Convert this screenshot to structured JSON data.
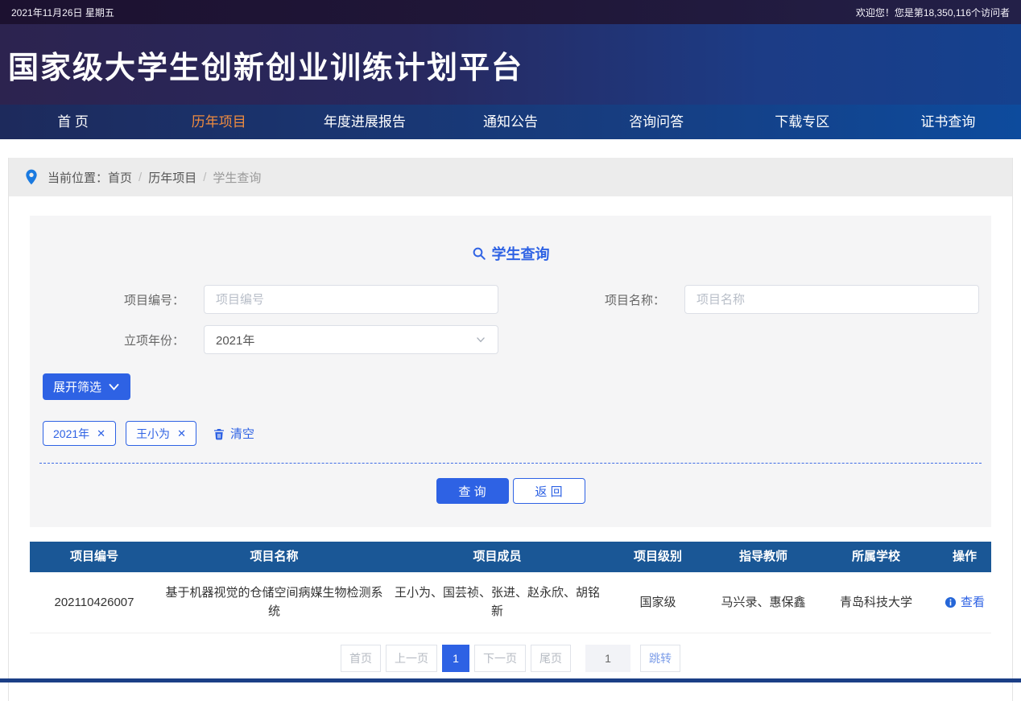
{
  "topbar": {
    "date": "2021年11月26日 星期五",
    "welcome": "欢迎您！您是第18,350,116个访问者"
  },
  "header": {
    "title": "国家级大学生创新创业训练计划平台"
  },
  "nav": {
    "items": [
      "首 页",
      "历年项目",
      "年度进展报告",
      "通知公告",
      "咨询问答",
      "下载专区",
      "证书查询"
    ],
    "active_item": "历年项目"
  },
  "breadcrumb": {
    "prefix": "当前位置：",
    "items": [
      "首页",
      "历年项目",
      "学生查询"
    ],
    "separator": "/"
  },
  "search": {
    "title": "学生查询",
    "fields": {
      "project_code": {
        "label": "项目编号：",
        "placeholder": "项目编号",
        "value": ""
      },
      "project_name": {
        "label": "项目名称：",
        "placeholder": "项目名称",
        "value": ""
      },
      "year": {
        "label": "立项年份：",
        "value": "2021年"
      }
    },
    "expand_label": "展开筛选",
    "tags": [
      "2021年",
      "王小为"
    ],
    "tag_close_glyph": "✕",
    "clear_label": "清空",
    "query_label": "查 询",
    "back_label": "返 回"
  },
  "table": {
    "headers": [
      "项目编号",
      "项目名称",
      "项目成员",
      "项目级别",
      "指导教师",
      "所属学校",
      "操作"
    ],
    "rows": [
      {
        "code": "202110426007",
        "name": "基于机器视觉的仓储空间病媒生物检测系统",
        "members": "王小为、国芸祯、张进、赵永欣、胡铭新",
        "level": "国家级",
        "teachers": "马兴录、惠保鑫",
        "school": "青岛科技大学",
        "action": "查看"
      }
    ]
  },
  "pagination": {
    "first": "首页",
    "prev": "上一页",
    "current": "1",
    "next": "下一页",
    "last": "尾页",
    "jump_value": "1",
    "jump_label": "跳转"
  },
  "icons": {
    "location-pin-icon": "map pin",
    "search-icon": "magnifier",
    "chevron-down-icon": "v",
    "close-icon": "✕",
    "trash-icon": "trash can",
    "info-icon": "i in circle"
  },
  "colors": {
    "accent_blue": "#2e62e4",
    "nav_active_orange": "#ef8b3f",
    "table_header_blue": "#1a5796",
    "topbar_dark": "#1c1130",
    "banner_left": "#2c234f",
    "banner_right": "#15418e"
  }
}
